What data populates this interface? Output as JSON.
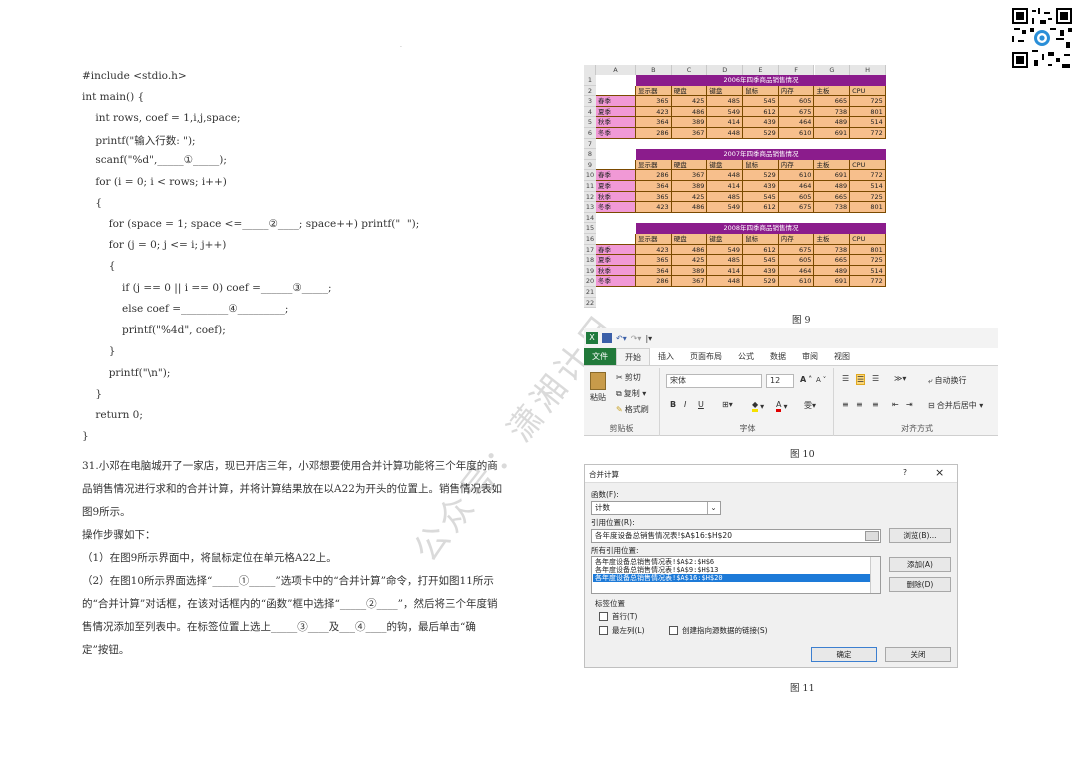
{
  "code_lines": [
    "#include <stdio.h>",
    "int main() {",
    "    int rows, coef = 1,i,j,space;",
    "    printf(\"输入行数: \");",
    "    scanf(\"%d\",_____①_____);",
    "    for (i = 0; i < rows; i++)",
    "    {",
    "        for (space = 1; space <=_____②____; space++) printf(\"  \");",
    "        for (j = 0; j <= i; j++)",
    "        {",
    "            if (j == 0 || i == 0) coef =______③_____;",
    "            else coef =_________④_________;",
    "            printf(\"%4d\", coef);",
    "        }",
    "        printf(\"\\n\");",
    "    }",
    "    return 0;",
    "}"
  ],
  "question": {
    "intro": "31.小邓在电脑城开了一家店，现已开店三年，小邓想要使用合并计算功能将三个年度的商品销售情况进行求和的合并计算，并将计算结果放在以A22为开头的位置上。销售情况表如图9所示。",
    "steps_title": "操作步骤如下：",
    "step1": "（1）在图9所示界面中，将鼠标定位在单元格A22上。",
    "step2": "（2）在图10所示界面选择“_____①_____”选项卡中的“合并计算”命令，打开如图11所示的“合并计算”对话框，在该对话框内的“函数”框中选择“_____②____”，然后将三个年度销售情况添加至列表中。在标签位置上选上_____③____及___④____的钩，最后单击“确定”按钮。"
  },
  "captions": {
    "fig9": "图 9",
    "fig10": "图 10",
    "fig11": "图 11"
  },
  "watermark": "公众号：潇湘计日",
  "sheet": {
    "columns": [
      "A",
      "B",
      "C",
      "D",
      "E",
      "F",
      "G",
      "H"
    ],
    "rows": [
      "1",
      "2",
      "3",
      "4",
      "5",
      "6",
      "7",
      "8",
      "9",
      "10",
      "11",
      "12",
      "13",
      "14",
      "15",
      "16",
      "17",
      "18",
      "19",
      "20",
      "21",
      "22"
    ],
    "headers": [
      "显示器",
      "硬盘",
      "键盘",
      "鼠标",
      "内存",
      "主板",
      "CPU"
    ],
    "tables": [
      {
        "title": "2006年四季商品销售情况",
        "rows": [
          {
            "label": "春季",
            "values": [
              365,
              425,
              485,
              545,
              605,
              665,
              725
            ]
          },
          {
            "label": "夏季",
            "values": [
              423,
              486,
              549,
              612,
              675,
              738,
              801
            ]
          },
          {
            "label": "秋季",
            "values": [
              364,
              389,
              414,
              439,
              464,
              489,
              514
            ]
          },
          {
            "label": "冬季",
            "values": [
              286,
              367,
              448,
              529,
              610,
              691,
              772
            ]
          }
        ]
      },
      {
        "title": "2007年四季商品销售情况",
        "rows": [
          {
            "label": "春季",
            "values": [
              286,
              367,
              448,
              529,
              610,
              691,
              772
            ]
          },
          {
            "label": "夏季",
            "values": [
              364,
              389,
              414,
              439,
              464,
              489,
              514
            ]
          },
          {
            "label": "秋季",
            "values": [
              365,
              425,
              485,
              545,
              605,
              665,
              725
            ]
          },
          {
            "label": "冬季",
            "values": [
              423,
              486,
              549,
              612,
              675,
              738,
              801
            ]
          }
        ]
      },
      {
        "title": "2008年四季商品销售情况",
        "rows": [
          {
            "label": "春季",
            "values": [
              423,
              486,
              549,
              612,
              675,
              738,
              801
            ]
          },
          {
            "label": "夏季",
            "values": [
              365,
              425,
              485,
              545,
              605,
              665,
              725
            ]
          },
          {
            "label": "秋季",
            "values": [
              364,
              389,
              414,
              439,
              464,
              489,
              514
            ]
          },
          {
            "label": "冬季",
            "values": [
              286,
              367,
              448,
              529,
              610,
              691,
              772
            ]
          }
        ]
      }
    ]
  },
  "ribbon": {
    "tabs": [
      "文件",
      "开始",
      "插入",
      "页面布局",
      "公式",
      "数据",
      "审阅",
      "视图"
    ],
    "clipboard": {
      "paste": "粘贴",
      "cut": "剪切",
      "copy": "复制 ▾",
      "painter": "格式刷",
      "label": "剪贴板"
    },
    "font": {
      "name": "宋体",
      "size": "12",
      "bold": "B",
      "italic": "I",
      "underline": "U",
      "grow": "A",
      "shrink": "A",
      "label": "字体"
    },
    "align": {
      "wrap": "自动换行",
      "merge": "合并后居中 ▾",
      "label": "对齐方式"
    }
  },
  "dialog": {
    "title": "合并计算",
    "help": "?",
    "close": "×",
    "function_label": "函数(F):",
    "function_value": "计数",
    "ref_label": "引用位置(R):",
    "ref_value": "各年度设备总销售情况表!$A$16:$H$20",
    "browse": "浏览(B)...",
    "all_refs_label": "所有引用位置:",
    "all_refs": [
      "各年度设备总销售情况表!$A$2:$H$6",
      "各年度设备总销售情况表!$A$9:$H$13",
      "各年度设备总销售情况表!$A$16:$H$20"
    ],
    "add": "添加(A)",
    "delete": "删除(D)",
    "label_pos": "标签位置",
    "first_row": "首行(T)",
    "left_col": "最左列(L)",
    "link": "创建指向源数据的链接(S)",
    "ok": "确定",
    "close_btn": "关闭"
  }
}
